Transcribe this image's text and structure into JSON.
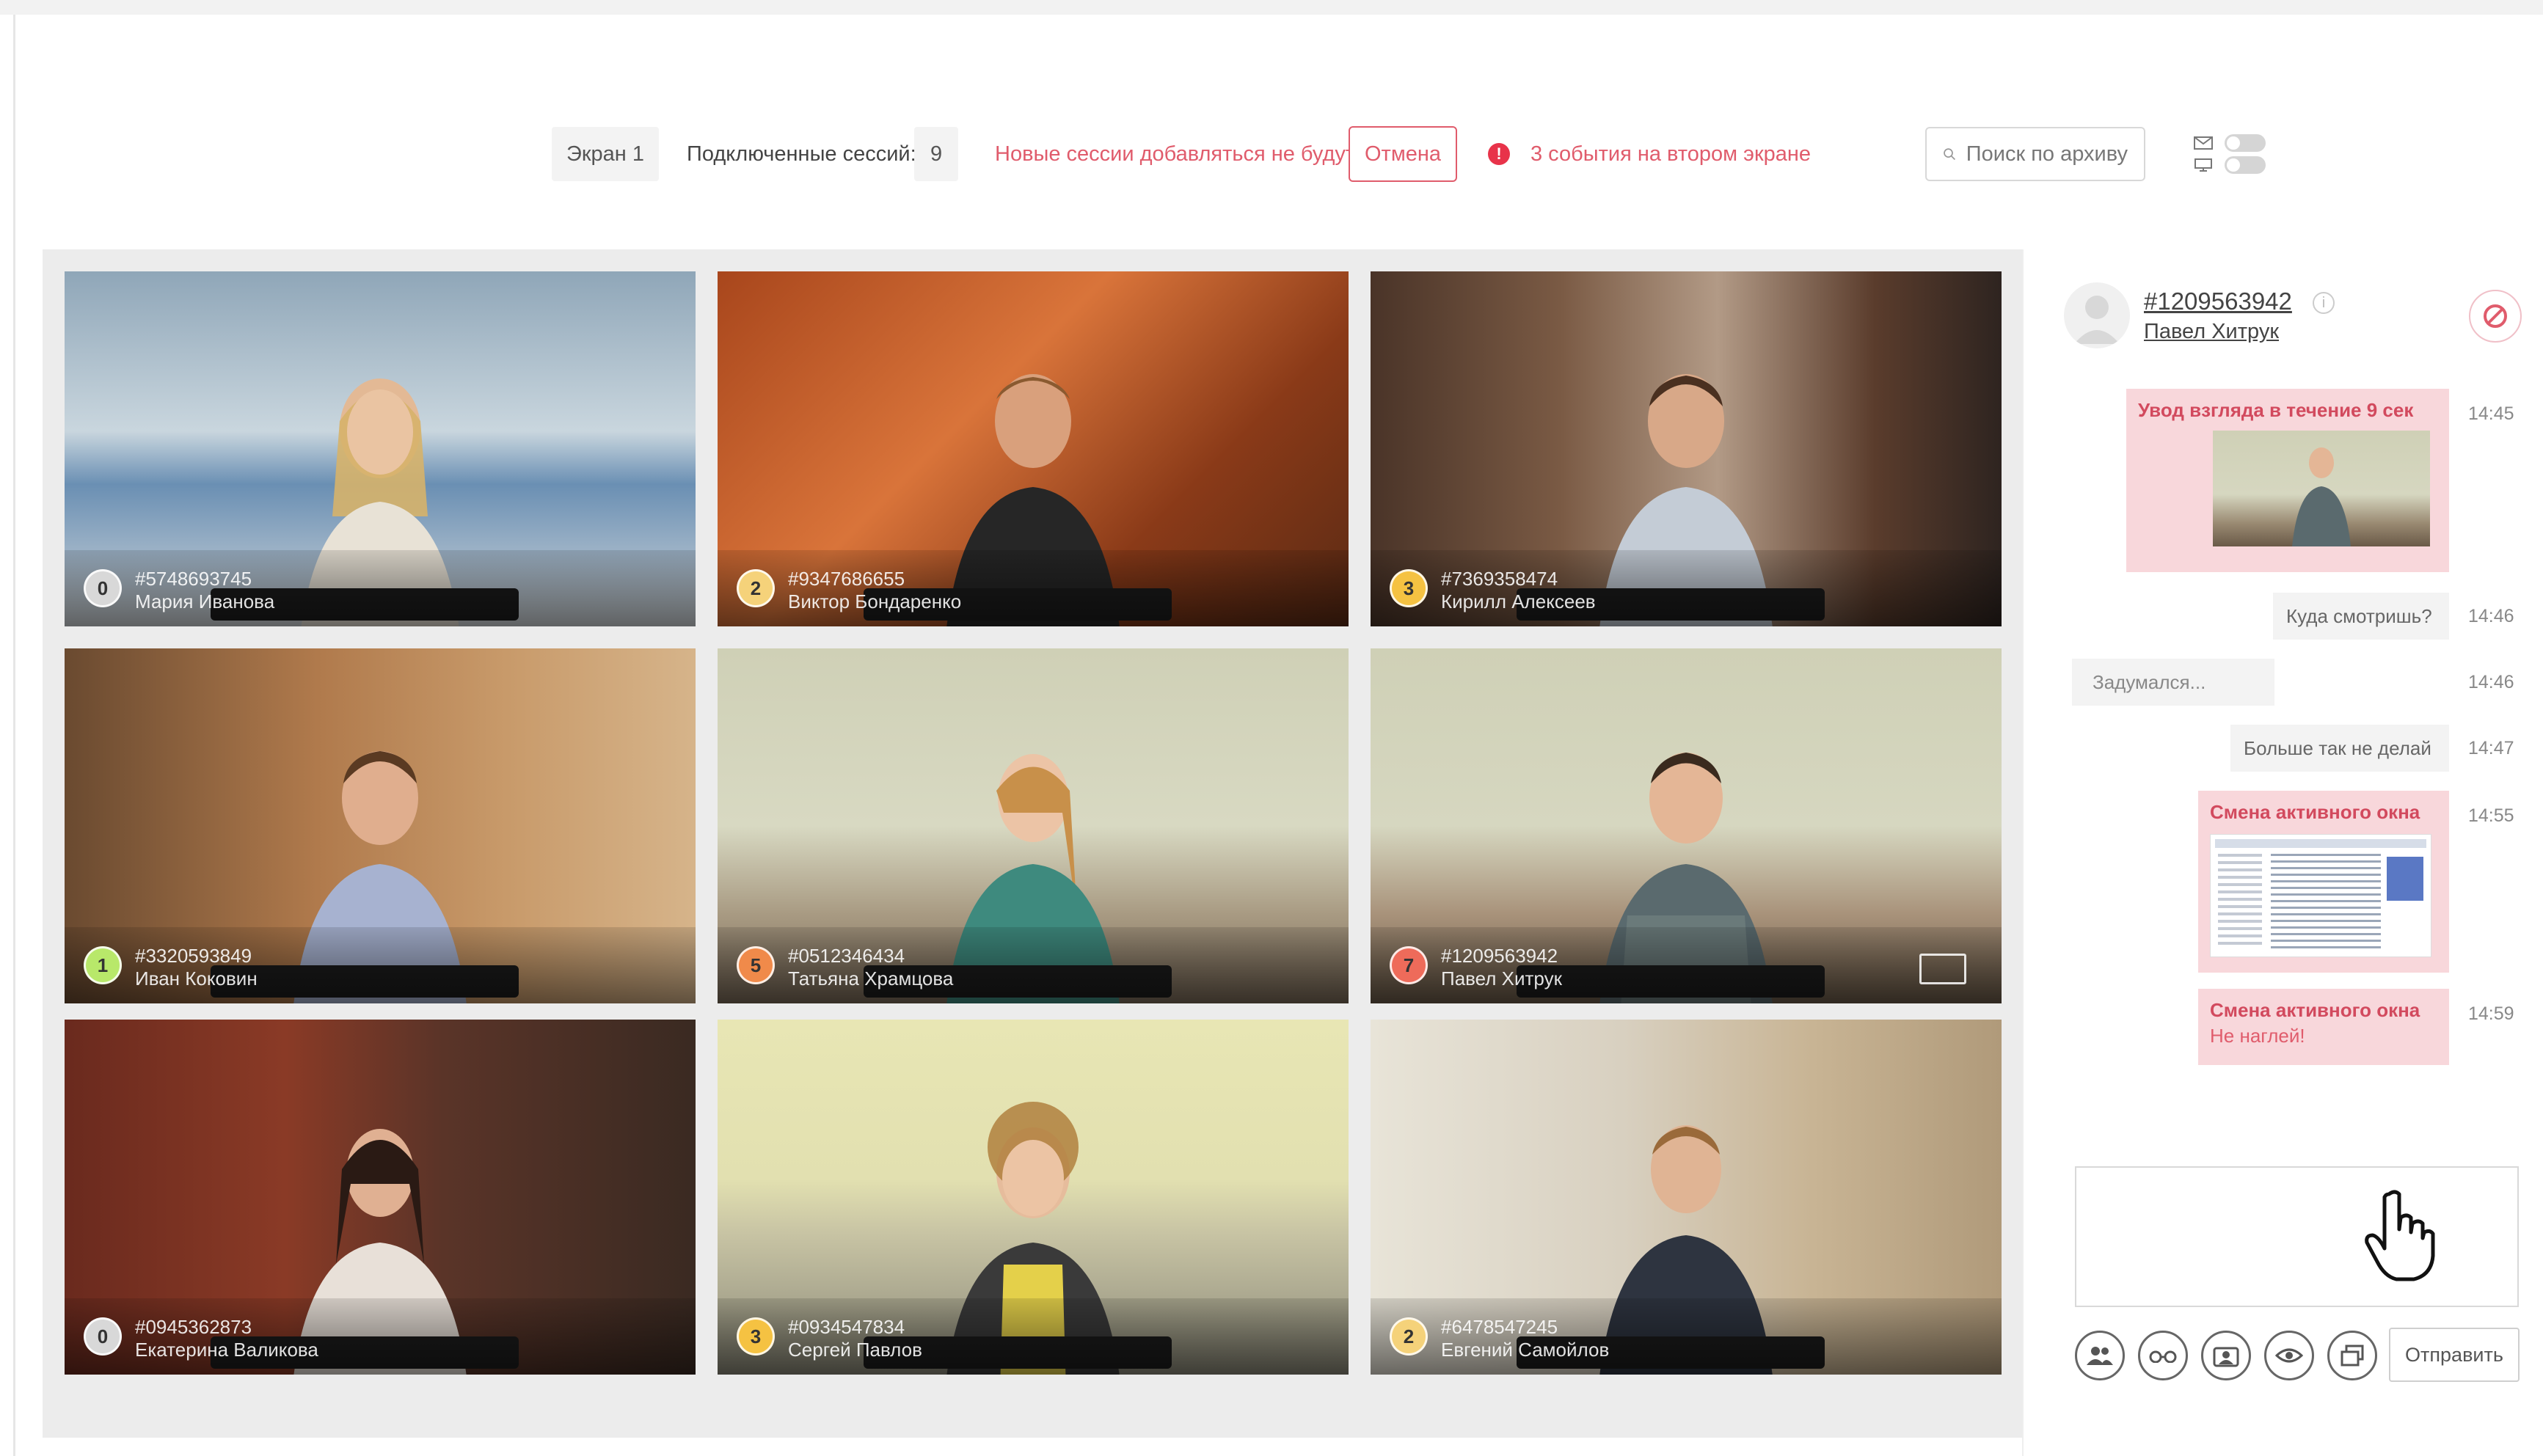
{
  "topbar": {
    "screen_label": "Экран 1",
    "sessions_label": "Подключенные сессий:",
    "sessions_count": "9",
    "notice": "Новые сессии добавляться не будут",
    "cancel_label": "Отмена",
    "alert_mark": "!",
    "alert_text": "3 события на втором экране",
    "search_placeholder": "Поиск по архиву"
  },
  "tiles": [
    {
      "badge": "0",
      "id": "#5748693745",
      "name": "Мария Иванова",
      "badge_color": "#d8d8d8"
    },
    {
      "badge": "2",
      "id": "#9347686655",
      "name": "Виктор Бондаренко",
      "badge_color": "#f5d27a"
    },
    {
      "badge": "3",
      "id": "#7369358474",
      "name": "Кирилл Алексеев",
      "badge_color": "#f5c242"
    },
    {
      "badge": "1",
      "id": "#3320593849",
      "name": "Иван Коковин",
      "badge_color": "#b8e86a"
    },
    {
      "badge": "5",
      "id": "#0512346434",
      "name": "Татьяна Храмцова",
      "badge_color": "#f08a4a"
    },
    {
      "badge": "7",
      "id": "#1209563942",
      "name": "Павел Хитрук",
      "badge_color": "#ee6b5a"
    },
    {
      "badge": "0",
      "id": "#0945362873",
      "name": "Екатерина Валикова",
      "badge_color": "#d8d8d8"
    },
    {
      "badge": "3",
      "id": "#0934547834",
      "name": "Сергей Павлов",
      "badge_color": "#f5c242"
    },
    {
      "badge": "2",
      "id": "#6478547245",
      "name": "Евгений Самойлов",
      "badge_color": "#f5d27a"
    }
  ],
  "chat": {
    "user_id": "#1209563942",
    "user_name": "Павел Хитрук",
    "info_mark": "i",
    "messages": [
      {
        "kind": "event",
        "text": "Увод взгляда в течение 9 сек",
        "time": "14:45"
      },
      {
        "kind": "out",
        "text": "Куда смотришь?",
        "time": "14:46"
      },
      {
        "kind": "in",
        "text": "Задумался...",
        "time": "14:46"
      },
      {
        "kind": "out",
        "text": "Больше так не делай",
        "time": "14:47"
      },
      {
        "kind": "event",
        "text": "Смена активного окна",
        "time": "14:55"
      },
      {
        "kind": "event",
        "text": "Смена активного окна",
        "sub": "Не наглей!",
        "time": "14:59"
      }
    ],
    "send_label": "Отправить"
  },
  "colors": {
    "accent": "#e05c6c",
    "alert": "#e8334a",
    "event_bg": "#f8d7db"
  },
  "icons": [
    "search-icon",
    "mail-icon",
    "monitor-icon",
    "info-icon",
    "block-icon",
    "group-icon",
    "glasses-icon",
    "user-card-icon",
    "eye-icon",
    "window-icon",
    "hand-cursor-icon",
    "expand-icon"
  ]
}
